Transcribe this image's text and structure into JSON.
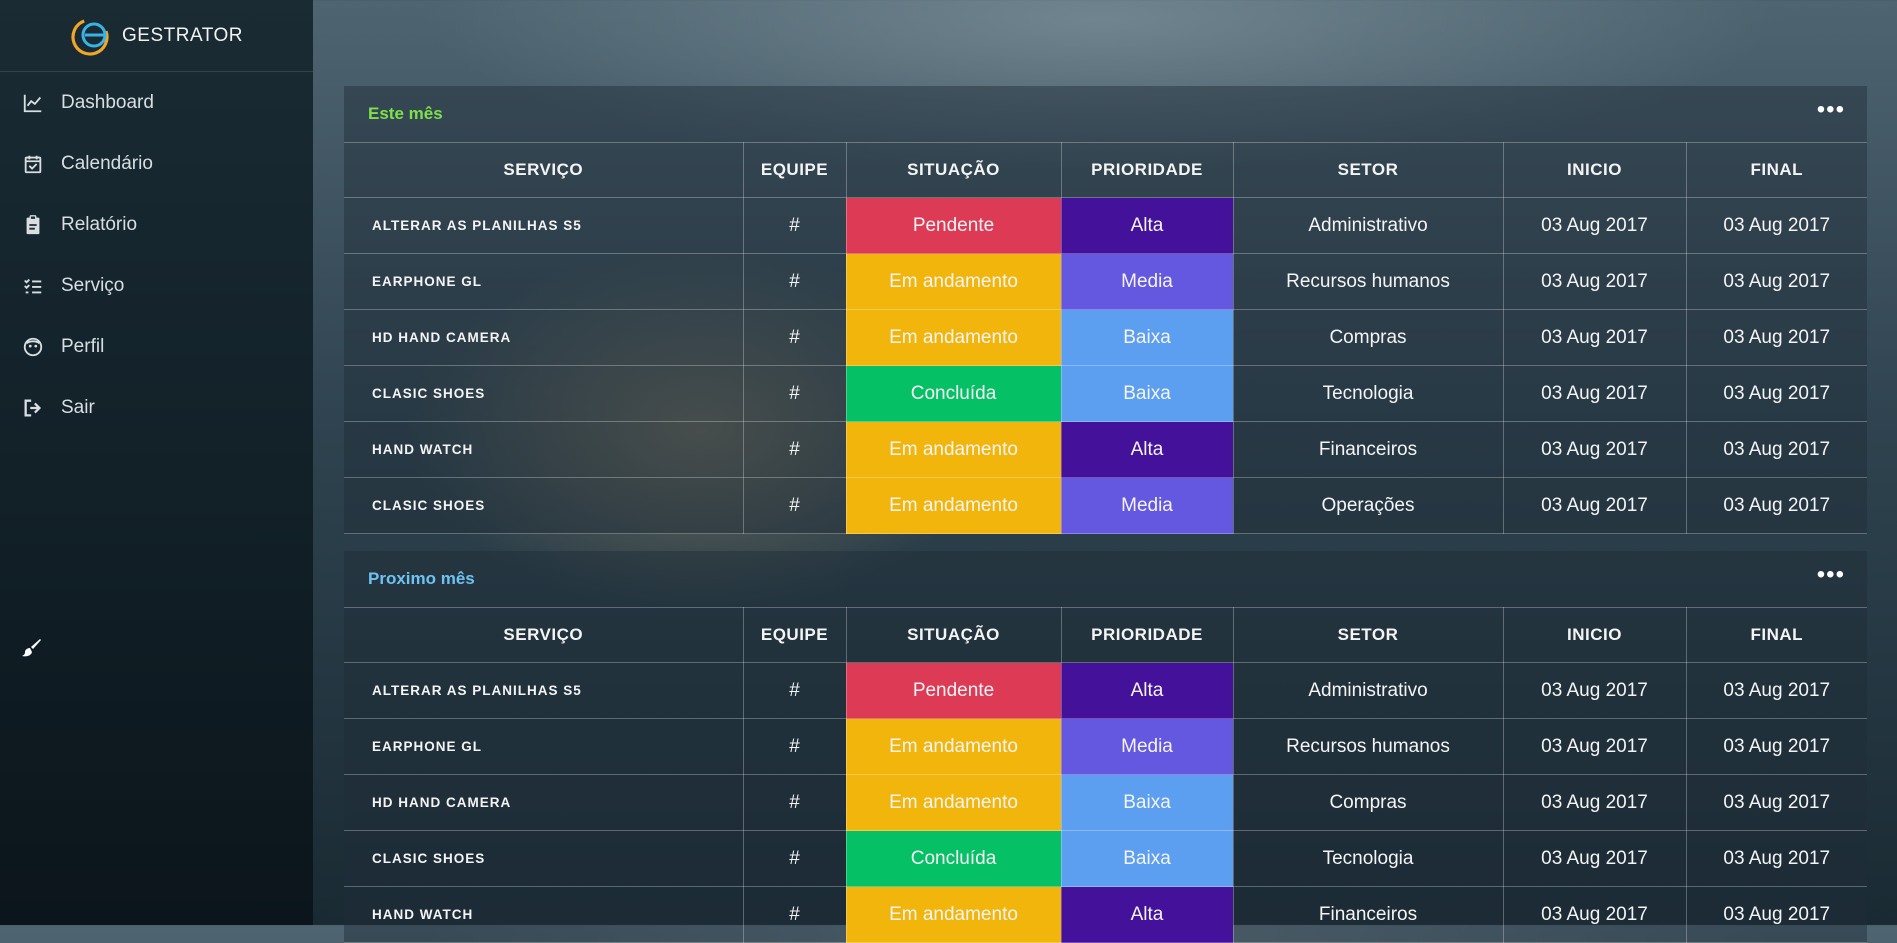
{
  "app": {
    "name": "GESTRATOR"
  },
  "sidebar": {
    "items": [
      {
        "label": "Dashboard",
        "icon": "chart-line-icon"
      },
      {
        "label": "Calendário",
        "icon": "calendar-check-icon"
      },
      {
        "label": "Relatório",
        "icon": "clipboard-icon"
      },
      {
        "label": "Serviço",
        "icon": "task-list-icon"
      },
      {
        "label": "Perfil",
        "icon": "face-icon"
      },
      {
        "label": "Sair",
        "icon": "sign-out-icon"
      }
    ],
    "theme_icon": "paint-brush-icon"
  },
  "colors": {
    "pendente": "#dc3a55",
    "em_andamento": "#f2b50c",
    "concluida": "#06c066",
    "alta": "#44119a",
    "media": "#6457e0",
    "baixa": "#5c9ff0",
    "title_this_month": "#7ee04b",
    "title_next_month": "#6ec3f0"
  },
  "columns": [
    "SERVIÇO",
    "EQUIPE",
    "SITUAÇÃO",
    "PRIORIDADE",
    "SETOR",
    "INICIO",
    "FINAL"
  ],
  "cards": [
    {
      "title": "Este mês",
      "menu": "•••",
      "rows": [
        {
          "servico": "ALTERAR AS PLANILHAS S5",
          "equipe": "#",
          "situacao": "Pendente",
          "prioridade": "Alta",
          "setor": "Administrativo",
          "inicio": "03 Aug 2017",
          "final": "03 Aug 2017"
        },
        {
          "servico": "EARPHONE GL",
          "equipe": "#",
          "situacao": "Em andamento",
          "prioridade": "Media",
          "setor": "Recursos humanos",
          "inicio": "03 Aug 2017",
          "final": "03 Aug 2017"
        },
        {
          "servico": "HD HAND CAMERA",
          "equipe": "#",
          "situacao": "Em andamento",
          "prioridade": "Baixa",
          "setor": "Compras",
          "inicio": "03 Aug 2017",
          "final": "03 Aug 2017"
        },
        {
          "servico": "CLASIC SHOES",
          "equipe": "#",
          "situacao": "Concluída",
          "prioridade": "Baixa",
          "setor": "Tecnologia",
          "inicio": "03 Aug 2017",
          "final": "03 Aug 2017"
        },
        {
          "servico": "HAND WATCH",
          "equipe": "#",
          "situacao": "Em andamento",
          "prioridade": "Alta",
          "setor": "Financeiros",
          "inicio": "03 Aug 2017",
          "final": "03 Aug 2017"
        },
        {
          "servico": "CLASIC SHOES",
          "equipe": "#",
          "situacao": "Em andamento",
          "prioridade": "Media",
          "setor": "Operações",
          "inicio": "03 Aug 2017",
          "final": "03 Aug 2017"
        }
      ]
    },
    {
      "title": "Proximo mês",
      "menu": "•••",
      "rows": [
        {
          "servico": "ALTERAR AS PLANILHAS S5",
          "equipe": "#",
          "situacao": "Pendente",
          "prioridade": "Alta",
          "setor": "Administrativo",
          "inicio": "03 Aug 2017",
          "final": "03 Aug 2017"
        },
        {
          "servico": "EARPHONE GL",
          "equipe": "#",
          "situacao": "Em andamento",
          "prioridade": "Media",
          "setor": "Recursos humanos",
          "inicio": "03 Aug 2017",
          "final": "03 Aug 2017"
        },
        {
          "servico": "HD HAND CAMERA",
          "equipe": "#",
          "situacao": "Em andamento",
          "prioridade": "Baixa",
          "setor": "Compras",
          "inicio": "03 Aug 2017",
          "final": "03 Aug 2017"
        },
        {
          "servico": "CLASIC SHOES",
          "equipe": "#",
          "situacao": "Concluída",
          "prioridade": "Baixa",
          "setor": "Tecnologia",
          "inicio": "03 Aug 2017",
          "final": "03 Aug 2017"
        },
        {
          "servico": "HAND WATCH",
          "equipe": "#",
          "situacao": "Em andamento",
          "prioridade": "Alta",
          "setor": "Financeiros",
          "inicio": "03 Aug 2017",
          "final": "03 Aug 2017"
        }
      ]
    }
  ]
}
